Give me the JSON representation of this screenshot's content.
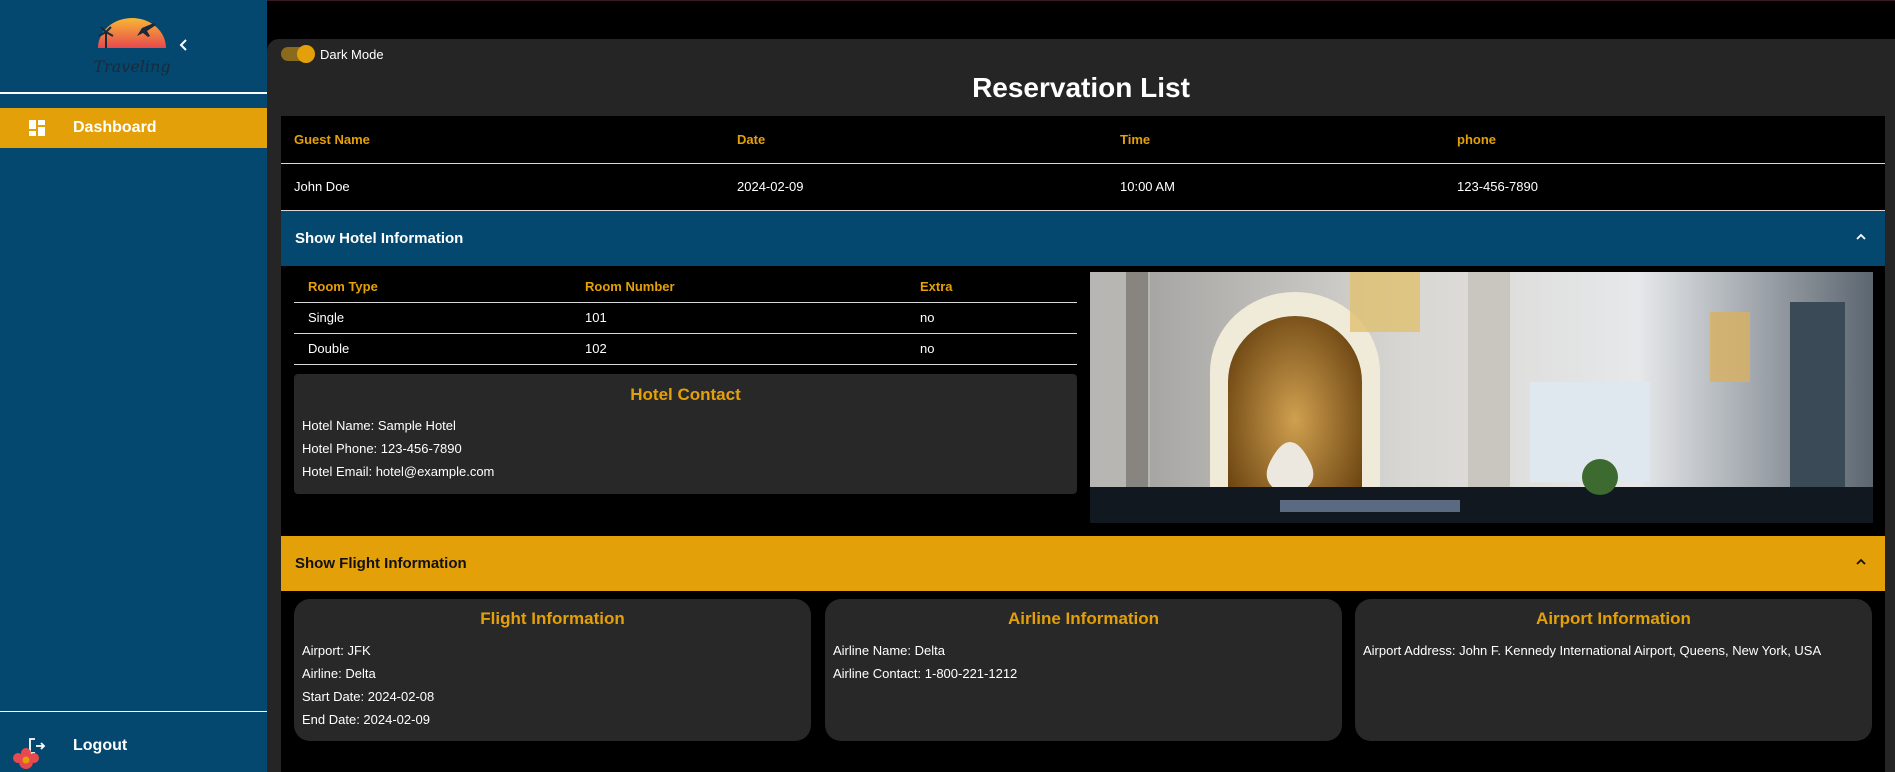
{
  "sidebar": {
    "logo_text": "Traveling",
    "collapse_icon": "chevron-left-icon",
    "nav": [
      {
        "label": "Dashboard",
        "icon": "dashboard-grid-icon",
        "active": true
      },
      {
        "label": "Logout",
        "icon": "logout-icon",
        "active": false
      }
    ]
  },
  "header": {
    "dark_mode_label": "Dark Mode",
    "dark_mode_on": true
  },
  "page_title": "Reservation List",
  "reservation": {
    "columns": [
      "Guest Name",
      "Date",
      "Time",
      "phone"
    ],
    "rows": [
      [
        "John Doe",
        "2024-02-09",
        "10:00 AM",
        "123-456-7890"
      ]
    ]
  },
  "hotel_section": {
    "header": "Show Hotel Information",
    "room_columns": [
      "Room Type",
      "Room Number",
      "Extra"
    ],
    "rooms": [
      [
        "Single",
        "101",
        "no"
      ],
      [
        "Double",
        "102",
        "no"
      ]
    ],
    "contact": {
      "title": "Hotel Contact",
      "lines": [
        "Hotel Name: Sample Hotel",
        "Hotel Phone: 123-456-7890",
        "Hotel Email: hotel@example.com"
      ]
    }
  },
  "flight_section": {
    "header": "Show Flight Information",
    "cards": [
      {
        "title": "Flight Information",
        "lines": [
          "Airport: JFK",
          "Airline: Delta",
          "Start Date: 2024-02-08",
          "End Date: 2024-02-09"
        ]
      },
      {
        "title": "Airline Information",
        "lines": [
          "Airline Name: Delta",
          "Airline Contact: 1-800-221-1212"
        ]
      },
      {
        "title": "Airport Information",
        "lines": [
          "Airport Address: John F. Kennedy International Airport, Queens, New York, USA"
        ]
      }
    ]
  },
  "colors": {
    "accent": "#E4A008",
    "sidebar": "#044870",
    "panel": "#252525"
  }
}
